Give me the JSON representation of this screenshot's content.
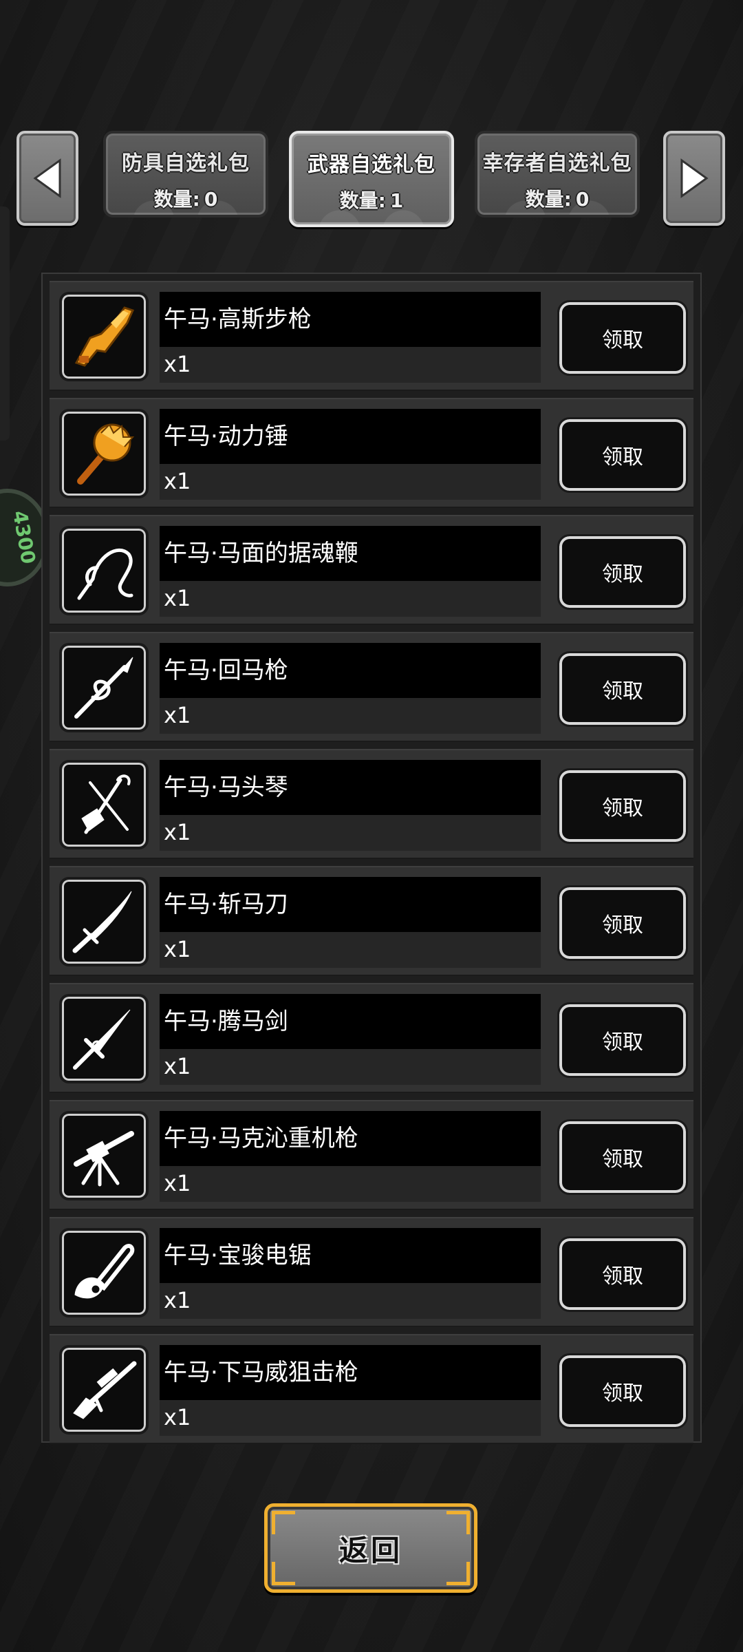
{
  "tabs": [
    {
      "title": "防具自选礼包",
      "count_label": "数量:",
      "count": "0",
      "active": false
    },
    {
      "title": "武器自选礼包",
      "count_label": "数量:",
      "count": "1",
      "active": true
    },
    {
      "title": "幸存者自选礼包",
      "count_label": "数量:",
      "count": "0",
      "active": false
    }
  ],
  "nav": {
    "prev_icon": "triangle-left-icon",
    "next_icon": "triangle-right-icon"
  },
  "side_badge": {
    "text": "4300"
  },
  "items": [
    {
      "name": "午马·高斯步枪",
      "qty": "x1",
      "claim": "领取",
      "icon": "gauss-rifle-icon",
      "icon_color": "#f0a020"
    },
    {
      "name": "午马·动力锤",
      "qty": "x1",
      "claim": "领取",
      "icon": "power-hammer-icon",
      "icon_color": "#f0a020"
    },
    {
      "name": "午马·马面的据魂鞭",
      "qty": "x1",
      "claim": "领取",
      "icon": "soul-whip-icon",
      "icon_color": "#ffffff"
    },
    {
      "name": "午马·回马枪",
      "qty": "x1",
      "claim": "领取",
      "icon": "spear-icon",
      "icon_color": "#ffffff"
    },
    {
      "name": "午马·马头琴",
      "qty": "x1",
      "claim": "领取",
      "icon": "horsehead-fiddle-icon",
      "icon_color": "#ffffff"
    },
    {
      "name": "午马·斩马刀",
      "qty": "x1",
      "claim": "领取",
      "icon": "saber-icon",
      "icon_color": "#ffffff"
    },
    {
      "name": "午马·腾马剑",
      "qty": "x1",
      "claim": "领取",
      "icon": "sword-icon",
      "icon_color": "#ffffff"
    },
    {
      "name": "午马·马克沁重机枪",
      "qty": "x1",
      "claim": "领取",
      "icon": "heavy-machine-gun-icon",
      "icon_color": "#ffffff"
    },
    {
      "name": "午马·宝骏电锯",
      "qty": "x1",
      "claim": "领取",
      "icon": "chainsaw-icon",
      "icon_color": "#ffffff"
    },
    {
      "name": "午马·下马威狙击枪",
      "qty": "x1",
      "claim": "领取",
      "icon": "sniper-rifle-icon",
      "icon_color": "#ffffff"
    }
  ],
  "back_button": {
    "label": "返回"
  }
}
